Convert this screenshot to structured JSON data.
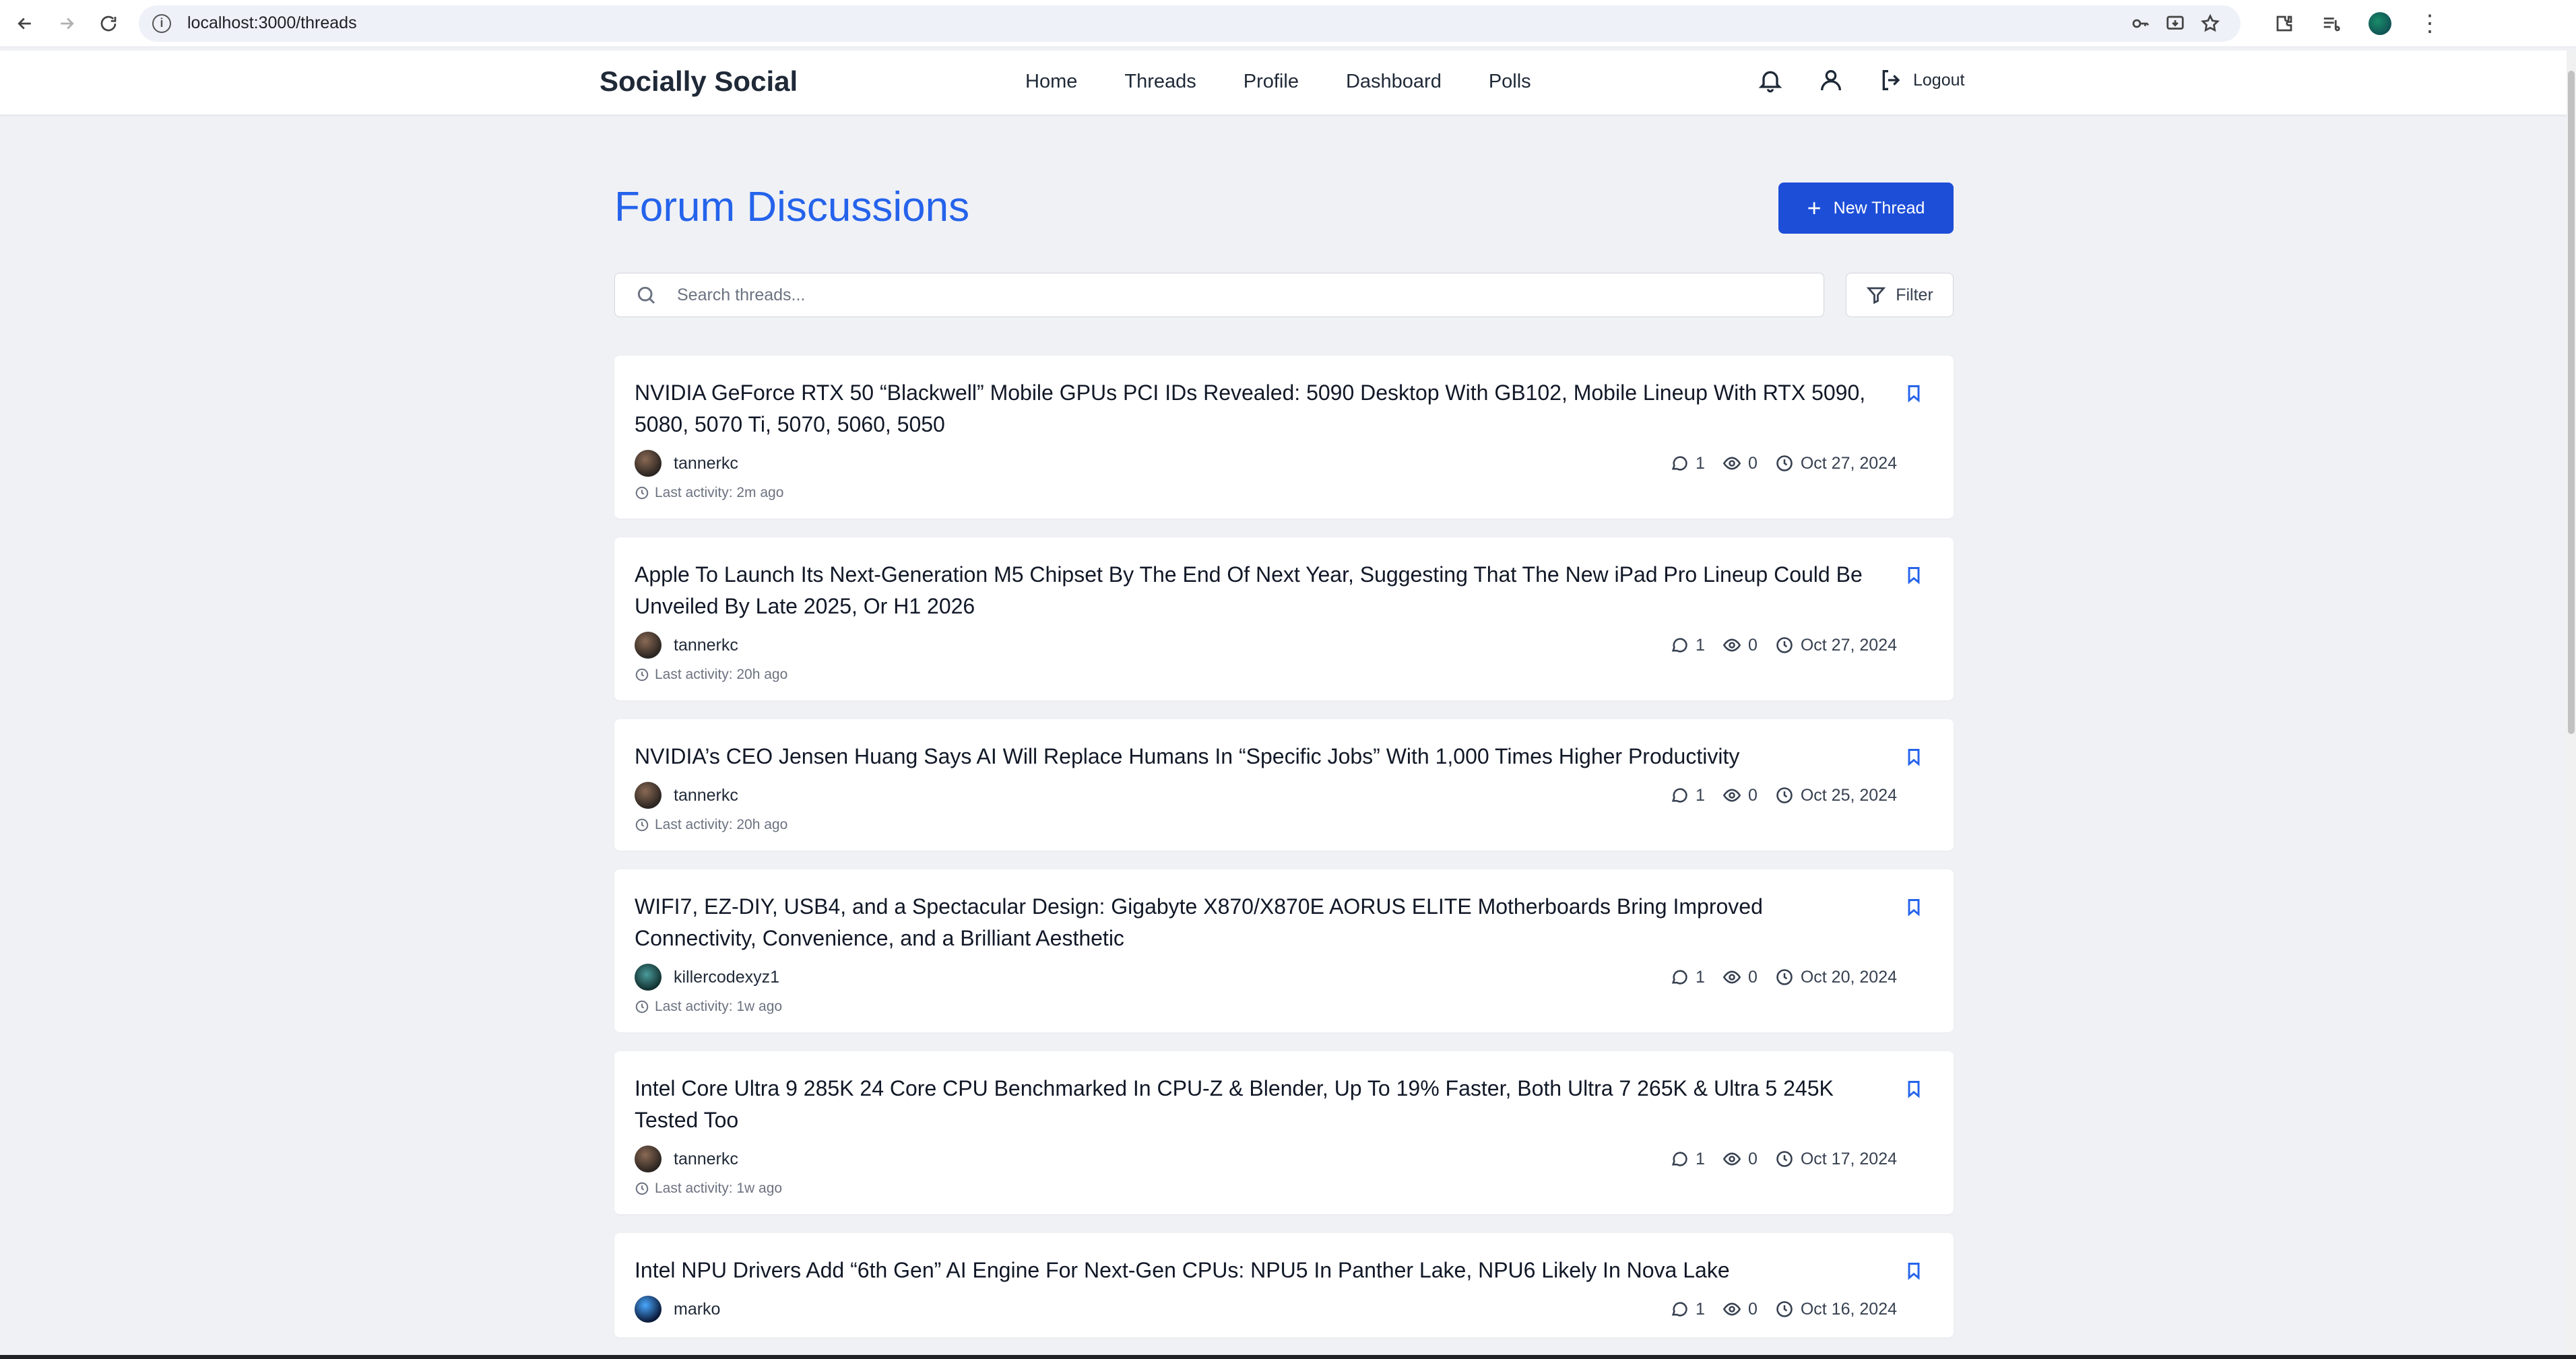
{
  "browser": {
    "url": "localhost:3000/threads"
  },
  "header": {
    "brand": "Socially Social",
    "nav": [
      "Home",
      "Threads",
      "Profile",
      "Dashboard",
      "Polls"
    ],
    "logout_label": "Logout"
  },
  "main": {
    "title": "Forum Discussions",
    "new_thread_label": "New Thread",
    "search_placeholder": "Search threads...",
    "filter_label": "Filter"
  },
  "threads": [
    {
      "title": "NVIDIA GeForce RTX 50 “Blackwell” Mobile GPUs PCI IDs Revealed: 5090 Desktop With GB102, Mobile Lineup With RTX 5090, 5080, 5070 Ti, 5070, 5060, 5050",
      "author": "tannerkc",
      "comments": "1",
      "views": "0",
      "date": "Oct 27, 2024",
      "last_activity": "Last activity: 2m ago"
    },
    {
      "title": "Apple To Launch Its Next-Generation M5 Chipset By The End Of Next Year, Suggesting That The New iPad Pro Lineup Could Be Unveiled By Late 2025, Or H1 2026",
      "author": "tannerkc",
      "comments": "1",
      "views": "0",
      "date": "Oct 27, 2024",
      "last_activity": "Last activity: 20h ago"
    },
    {
      "title": "NVIDIA’s CEO Jensen Huang Says AI Will Replace Humans In “Specific Jobs” With 1,000 Times Higher Productivity",
      "author": "tannerkc",
      "comments": "1",
      "views": "0",
      "date": "Oct 25, 2024",
      "last_activity": "Last activity: 20h ago"
    },
    {
      "title": "WIFI7, EZ-DIY, USB4, and a Spectacular Design: Gigabyte X870/X870E AORUS ELITE Motherboards Bring Improved Connectivity, Convenience, and a Brilliant Aesthetic",
      "author": "killercodexyz1",
      "comments": "1",
      "views": "0",
      "date": "Oct 20, 2024",
      "last_activity": "Last activity: 1w ago"
    },
    {
      "title": "Intel Core Ultra 9 285K 24 Core CPU Benchmarked In CPU-Z & Blender, Up To 19% Faster, Both Ultra 7 265K & Ultra 5 245K Tested Too",
      "author": "tannerkc",
      "comments": "1",
      "views": "0",
      "date": "Oct 17, 2024",
      "last_activity": "Last activity: 1w ago"
    },
    {
      "title": "Intel NPU Drivers Add “6th Gen” AI Engine For Next-Gen CPUs: NPU5 In Panther Lake, NPU6 Likely In Nova Lake",
      "author": "marko",
      "comments": "1",
      "views": "0",
      "date": "Oct 16, 2024",
      "last_activity": ""
    }
  ],
  "colors": {
    "accent": "#2563eb",
    "button": "#1d4ed8",
    "background": "#f0f1f5"
  }
}
